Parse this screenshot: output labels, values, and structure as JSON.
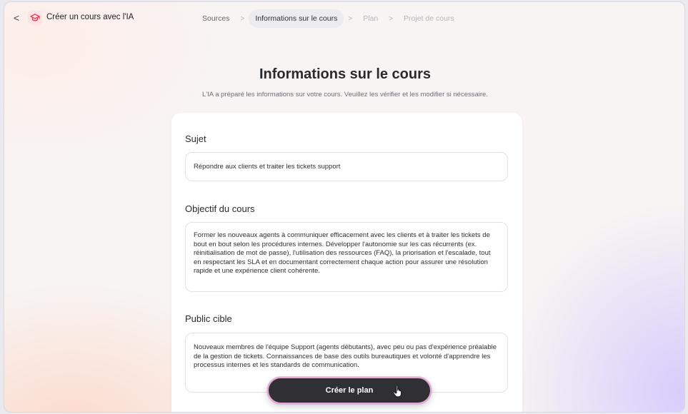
{
  "app": {
    "title": "Créer un cours avec l'IA",
    "back_symbol": "<",
    "logo_icon": "graduation-cap-icon",
    "accent": "#e0425a"
  },
  "stepper": {
    "steps": [
      {
        "label": "Sources",
        "state": "done"
      },
      {
        "label": "Informations sur le cours",
        "state": "active"
      },
      {
        "label": "Plan",
        "state": "disabled"
      },
      {
        "label": "Projet de cours",
        "state": "disabled"
      }
    ],
    "separator": ">"
  },
  "page": {
    "title": "Informations sur le cours",
    "subtitle": "L'IA a préparé les informations sur votre cours. Veuillez les vérifier et les modifier si nécessaire."
  },
  "form": {
    "subject": {
      "label": "Sujet",
      "value": "Répondre aux clients et traiter les tickets support"
    },
    "objective": {
      "label": "Objectif du cours",
      "value": "Former les nouveaux agents à communiquer efficacement avec les clients et à traiter les tickets de bout en bout selon les procédures internes. Développer l'autonomie sur les cas récurrents (ex. réinitialisation de mot de passe), l'utilisation des ressources (FAQ), la priorisation et l'escalade, tout en respectant les SLA et en documentant correctement chaque action pour assurer une résolution rapide et une expérience client cohérente."
    },
    "audience": {
      "label": "Public cible",
      "value": "Nouveaux membres de l'équipe Support (agents débutants), avec peu ou pas d'expérience préalable de la gestion de tickets. Connaissances de base des outils bureautiques et volonté d'apprendre les processus internes et les standards de communication."
    }
  },
  "cta": {
    "label": "Créer le plan",
    "cursor_icon": "hand-pointer-icon"
  }
}
